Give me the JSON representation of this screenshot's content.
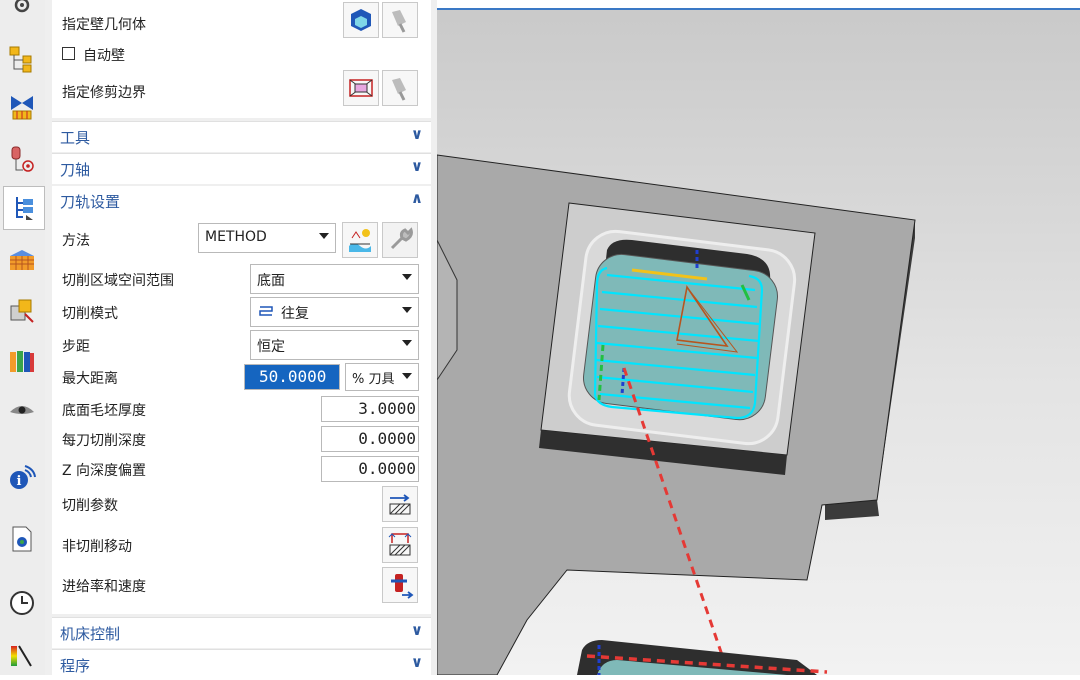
{
  "panel": {
    "wall_geometry_label": "指定壁几何体",
    "auto_wall_label": "自动壁",
    "trim_boundary_label": "指定修剪边界",
    "tools_header": "工具",
    "tool_axis_header": "刀轴",
    "path_settings_header": "刀轨设置",
    "method_label": "方法",
    "method_value": "METHOD",
    "cut_region_label": "切削区域空间范围",
    "cut_region_value": "底面",
    "cut_pattern_label": "切削模式",
    "cut_pattern_value": "往复",
    "stepover_label": "步距",
    "stepover_value": "恒定",
    "max_distance_label": "最大距离",
    "max_distance_value": "50.0000",
    "max_distance_unit": "% 刀具",
    "floor_blank_label": "底面毛坯厚度",
    "floor_blank_value": "3.0000",
    "depth_per_cut_label": "每刀切削深度",
    "depth_per_cut_value": "0.0000",
    "z_offset_label": "Z 向深度偏置",
    "z_offset_value": "0.0000",
    "cut_params_label": "切削参数",
    "non_cut_moves_label": "非切削移动",
    "feeds_speeds_label": "进给率和速度",
    "machine_control_header": "机床控制",
    "program_header": "程序"
  },
  "colors": {
    "accent": "#2d5aa0",
    "selection": "#1565c0",
    "toolpath": "#00e5ff",
    "rapid": "#e53935"
  },
  "icons": [
    "settings-icon",
    "part-navigator-icon",
    "assembly-constraint-icon",
    "machine-tool-icon",
    "operation-navigator-icon",
    "pallet-icon",
    "assembly-icon",
    "library-icon",
    "visualization-icon",
    "info-icon",
    "document-icon",
    "history-icon",
    "color-palette-icon"
  ]
}
